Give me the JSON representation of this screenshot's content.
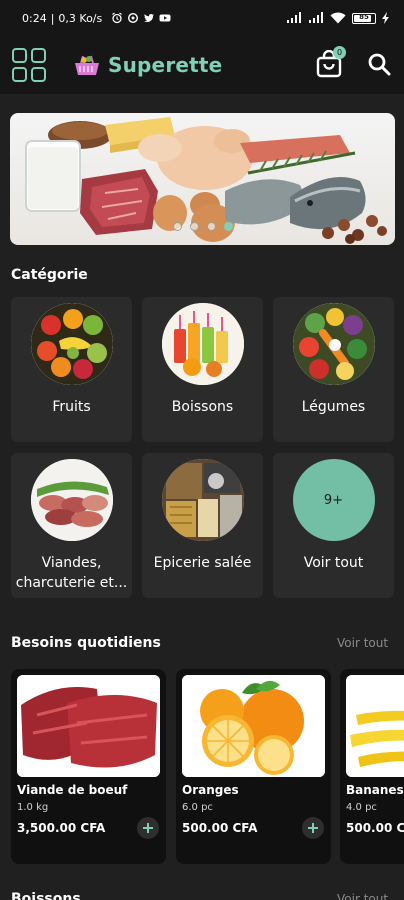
{
  "status": {
    "time": "0:24",
    "speed": "0,3 Ko/s",
    "battery": "85"
  },
  "appbar": {
    "title": "Superette",
    "cart_count": "0"
  },
  "categories_section": {
    "title": "Catégorie",
    "items": [
      {
        "label": "Fruits"
      },
      {
        "label": "Boissons"
      },
      {
        "label": "Légumes"
      },
      {
        "label": "Viandes, charcuterie et..."
      },
      {
        "label": "Epicerie salée"
      },
      {
        "label": "Voir tout",
        "badge": "9+"
      }
    ]
  },
  "daily": {
    "title": "Besoins quotidiens",
    "see_all": "Voir tout",
    "products": [
      {
        "name": "Viande de boeuf",
        "unit": "1.0 kg",
        "price": "3,500.00 CFA"
      },
      {
        "name": "Oranges",
        "unit": "6.0 pc",
        "price": "500.00 CFA"
      },
      {
        "name": "Bananes",
        "unit": "4.0 pc",
        "price": "500.00 CFA"
      }
    ]
  },
  "drinks": {
    "title": "Boissons",
    "see_all": "Voir tout"
  },
  "colors": {
    "accent": "#7fd0b6",
    "background": "#202020",
    "card": "#2b2b2b"
  }
}
